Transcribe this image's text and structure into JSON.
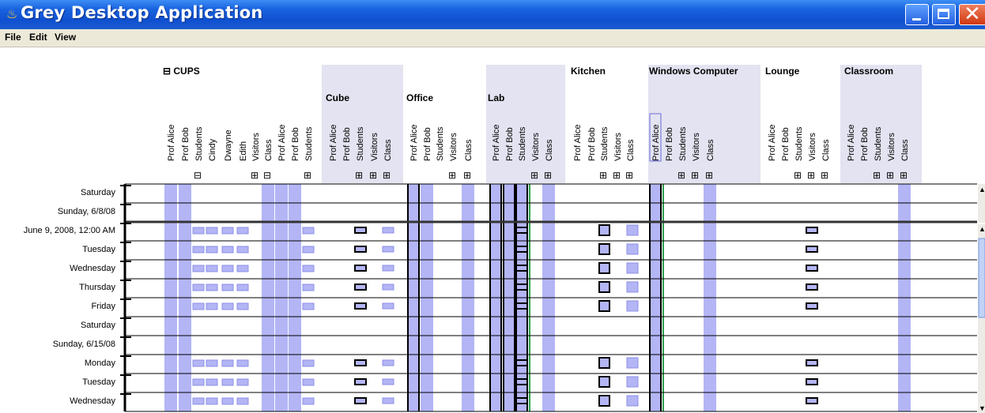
{
  "window": {
    "title": "Grey Desktop Application"
  },
  "menu": [
    "File",
    "Edit",
    "View"
  ],
  "colors": {
    "bar": "#b3b5f5",
    "barEdge": "#8c8fe8",
    "groupBg": "#e3e3f1",
    "titleBar": "#1a64e0",
    "green": "#2e9e4e"
  },
  "groups": [
    {
      "name": "CUPS",
      "prefix": "⊟ ",
      "collapsible": true
    },
    {
      "name": "Cube",
      "shaded": true
    },
    {
      "name": "Office"
    },
    {
      "name": "Lab",
      "shaded": true
    },
    {
      "name": "Kitchen"
    },
    {
      "name": "Windows Computer",
      "shaded": true
    },
    {
      "name": "Lounge"
    },
    {
      "name": "Classroom",
      "shaded": true
    }
  ],
  "columns": [
    {
      "label": "Prof Alice",
      "bar": true
    },
    {
      "label": "Prof Bob",
      "bar": true
    },
    {
      "label": "Students",
      "toggle": "⊟"
    },
    {
      "label": "Cindy"
    },
    {
      "label": "Dwayne"
    },
    {
      "label": "Edith"
    },
    {
      "label": "Visitors",
      "toggle": "⊞"
    },
    {
      "label": "Class",
      "toggle": "⊟",
      "bar": true
    },
    {
      "label": "Prof Alice",
      "bar": true
    },
    {
      "label": "Prof Bob",
      "bar": true
    },
    {
      "label": "Students",
      "toggle": "⊞"
    },
    {
      "label": "Prof Alice"
    },
    {
      "label": "Prof Bob"
    },
    {
      "label": "Students",
      "toggle": "⊞"
    },
    {
      "label": "Visitors",
      "toggle": "⊞"
    },
    {
      "label": "Class",
      "toggle": "⊞"
    },
    {
      "label": "Prof Alice",
      "dark": true
    },
    {
      "label": "Prof Bob",
      "bar": true
    },
    {
      "label": "Students"
    },
    {
      "label": "Visitors",
      "toggle": "⊞"
    },
    {
      "label": "Class",
      "toggle": "⊞",
      "bar": true
    },
    {
      "label": "Prof Alice",
      "dark": true
    },
    {
      "label": "Prof Bob",
      "dark": true
    },
    {
      "label": "Students",
      "dark": true
    },
    {
      "label": "Visitors",
      "toggle": "⊞"
    },
    {
      "label": "Class",
      "toggle": "⊞",
      "bar": true
    },
    {
      "label": "Prof Alice"
    },
    {
      "label": "Prof Bob"
    },
    {
      "label": "Students",
      "toggle": "⊞"
    },
    {
      "label": "Visitors",
      "toggle": "⊞"
    },
    {
      "label": "Class",
      "toggle": "⊞"
    },
    {
      "label": "Prof Alice",
      "selected": true,
      "dark": true
    },
    {
      "label": "Prof Bob"
    },
    {
      "label": "Students",
      "toggle": "⊞"
    },
    {
      "label": "Visitors",
      "toggle": "⊞"
    },
    {
      "label": "Class",
      "toggle": "⊞",
      "bar": true
    },
    {
      "label": "Prof Alice"
    },
    {
      "label": "Prof Bob"
    },
    {
      "label": "Students",
      "toggle": "⊞"
    },
    {
      "label": "Visitors",
      "toggle": "⊞"
    },
    {
      "label": "Class",
      "toggle": "⊞"
    },
    {
      "label": "Prof Alice"
    },
    {
      "label": "Prof Bob"
    },
    {
      "label": "Students",
      "toggle": "⊞"
    },
    {
      "label": "Visitors",
      "toggle": "⊞"
    },
    {
      "label": "Class",
      "toggle": "⊞",
      "bar": true
    }
  ],
  "rows": [
    {
      "label": "Saturday",
      "weekday": false
    },
    {
      "label": "Sunday, 6/8/08",
      "weekday": false
    },
    {
      "label": "June 9, 2008, 12:00 AM",
      "weekday": true
    },
    {
      "label": "Tuesday",
      "weekday": true
    },
    {
      "label": "Wednesday",
      "weekday": true
    },
    {
      "label": "Thursday",
      "weekday": true
    },
    {
      "label": "Friday",
      "weekday": true
    },
    {
      "label": "Saturday",
      "weekday": false
    },
    {
      "label": "Sunday, 6/15/08",
      "weekday": false
    },
    {
      "label": "Monday",
      "weekday": true
    },
    {
      "label": "Tuesday",
      "weekday": true
    },
    {
      "label": "Wednesday",
      "weekday": true
    }
  ]
}
